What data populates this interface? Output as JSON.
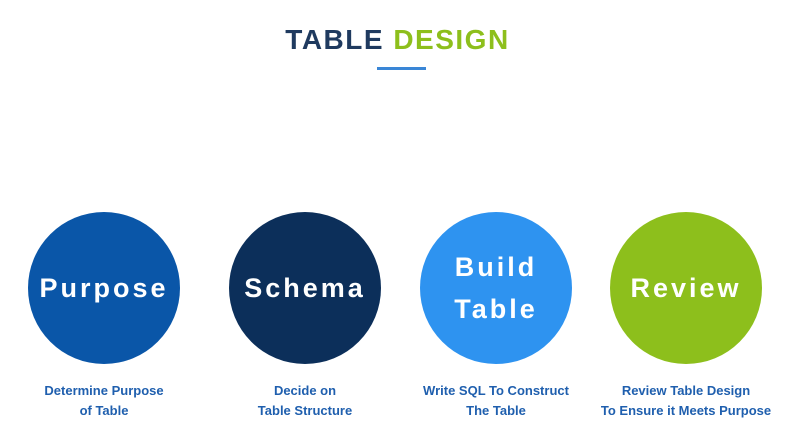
{
  "title": {
    "part1": "TABLE",
    "part2": "DESIGN"
  },
  "colors": {
    "title_part1": "#1f3a5f",
    "title_part2": "#8dbf1c",
    "underline": "#3a86d6",
    "caption": "#1f5fae"
  },
  "steps": [
    {
      "label_lines": [
        "Purpose"
      ],
      "color": "#0a56a8",
      "caption_lines": [
        "Determine Purpose",
        "of Table"
      ]
    },
    {
      "label_lines": [
        "Schema"
      ],
      "color": "#0c2f5a",
      "caption_lines": [
        "Decide on",
        "Table Structure"
      ]
    },
    {
      "label_lines": [
        "Build",
        "Table"
      ],
      "color": "#2e93f0",
      "caption_lines": [
        "Write SQL To Construct",
        "The Table"
      ]
    },
    {
      "label_lines": [
        "Review"
      ],
      "color": "#8dbf1c",
      "caption_lines": [
        "Review Table Design",
        "To Ensure it Meets Purpose"
      ]
    }
  ]
}
